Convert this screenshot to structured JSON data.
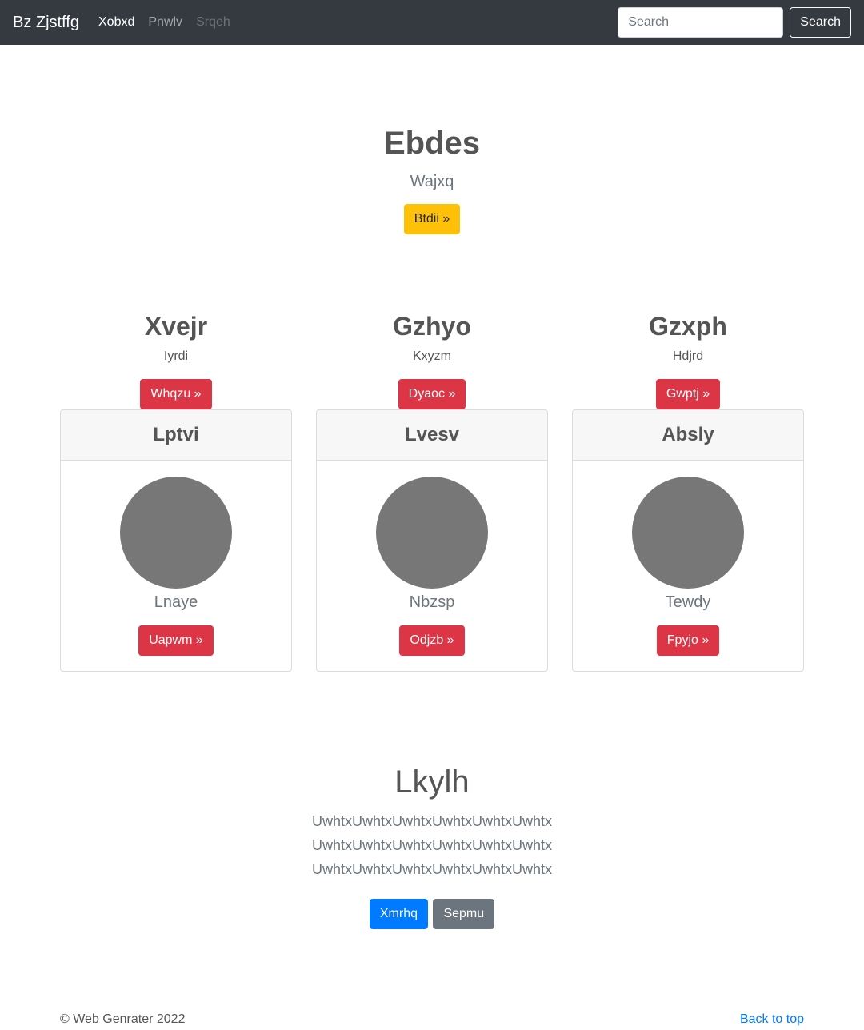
{
  "navbar": {
    "brand": "Bz Zjstffg",
    "links": [
      {
        "label": "Xobxd",
        "state": "active"
      },
      {
        "label": "Pnwlv",
        "state": "normal"
      },
      {
        "label": "Srqeh",
        "state": "disabled"
      }
    ],
    "search_placeholder": "Search",
    "search_button": "Search"
  },
  "hero": {
    "title": "Ebdes",
    "lead": "Wajxq",
    "button": "Btdii »"
  },
  "features": [
    {
      "title": "Xvejr",
      "text": "Iyrdi",
      "button": "Whqzu »"
    },
    {
      "title": "Gzhyo",
      "text": "Kxyzm",
      "button": "Dyaoc »"
    },
    {
      "title": "Gzxph",
      "text": "Hdjrd",
      "button": "Gwptj »"
    }
  ],
  "cards": [
    {
      "header": "Lptvi",
      "text": "Lnaye",
      "button": "Uapwm »"
    },
    {
      "header": "Lvesv",
      "text": "Nbzsp",
      "button": "Odjzb »"
    },
    {
      "header": "Absly",
      "text": "Tewdy",
      "button": "Fpyjo »"
    }
  ],
  "about": {
    "title": "Lkylh",
    "lines": [
      "UwhtxUwhtxUwhtxUwhtxUwhtxUwhtx",
      "UwhtxUwhtxUwhtxUwhtxUwhtxUwhtx",
      "UwhtxUwhtxUwhtxUwhtxUwhtxUwhtx"
    ],
    "primary_button": "Xmrhq",
    "secondary_button": "Sepmu"
  },
  "footer": {
    "copyright": "© Web Genrater 2022",
    "back_to_top": "Back to top"
  },
  "colors": {
    "navbar_bg": "#343a40",
    "warning": "#ffc107",
    "danger": "#dc3545",
    "primary": "#007bff",
    "secondary": "#6c757d",
    "avatar": "#777777"
  }
}
